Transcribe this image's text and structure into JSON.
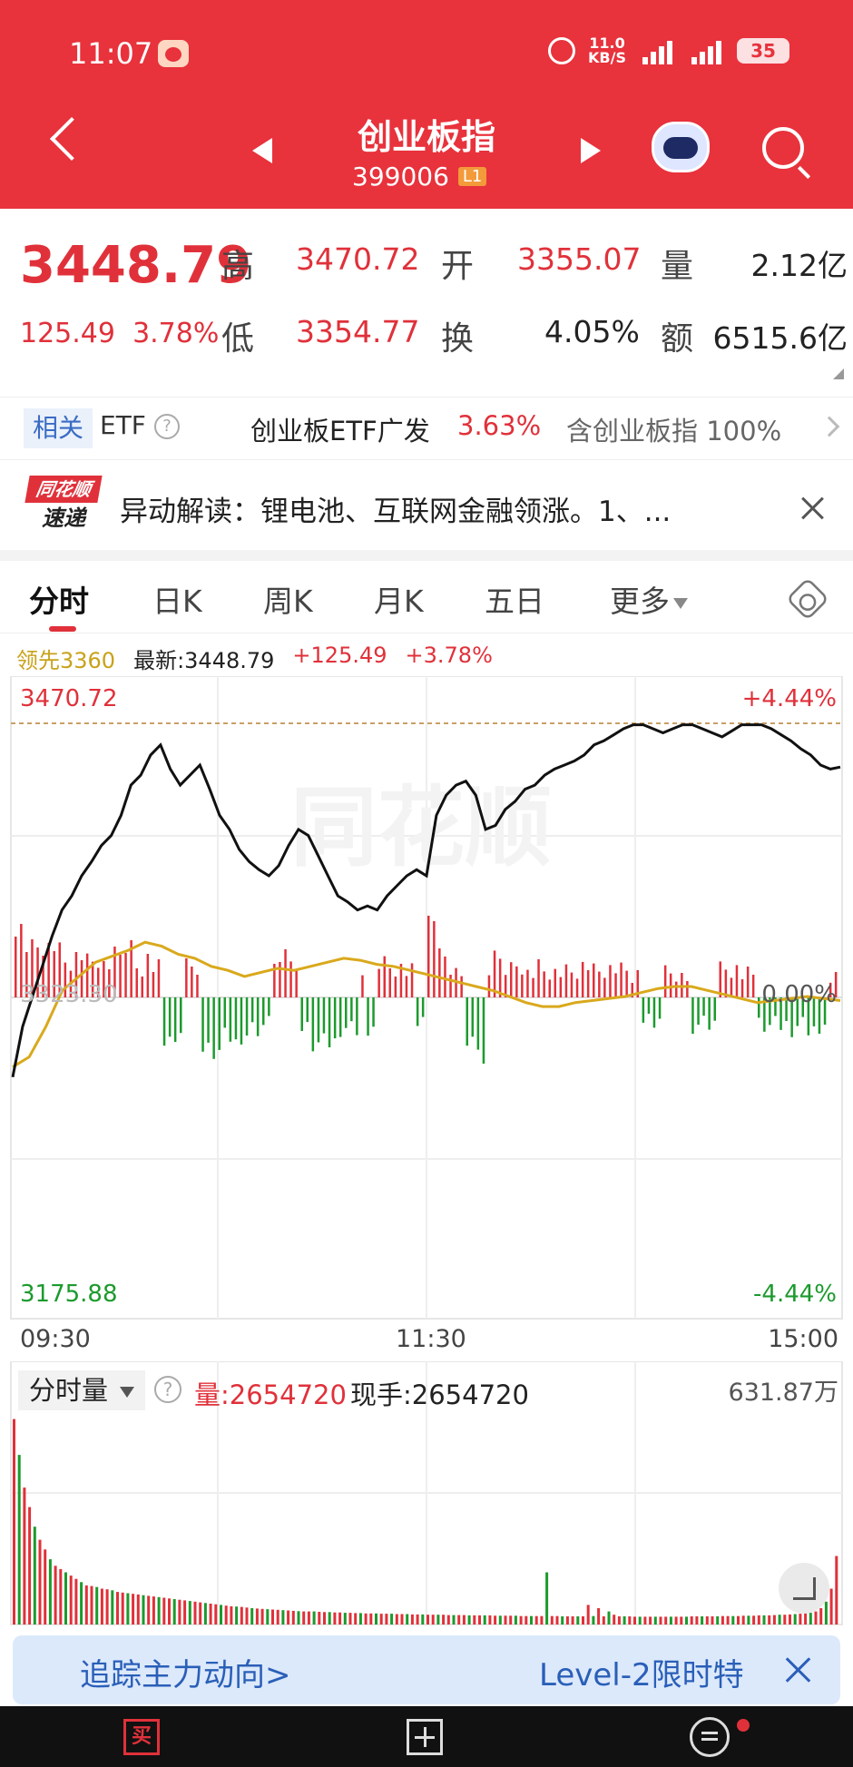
{
  "status": {
    "time": "11:07",
    "speed": "11.0\nKB/S",
    "net1": "5G",
    "net2": "5G",
    "battery": "35"
  },
  "header": {
    "title": "创业板指",
    "code": "399006",
    "level": "L1"
  },
  "quote": {
    "price": "3448.79",
    "change": "125.49",
    "change_pct": "3.78%",
    "high_label": "高",
    "high": "3470.72",
    "open_label": "开",
    "open": "3355.07",
    "volume_label": "量",
    "volume": "2.12亿",
    "low_label": "低",
    "low": "3354.77",
    "turnover_label": "换",
    "turnover": "4.05%",
    "amount_label": "额",
    "amount": "6515.6亿"
  },
  "related": {
    "tag": "相关",
    "type": "ETF",
    "help": "?",
    "name": "创业板ETF广发",
    "pct": "3.63%",
    "contains": "含创业板指 100%"
  },
  "news": {
    "logo_top": "同花顺",
    "logo_bottom": "速递",
    "text": "异动解读：锂电池、互联网金融领涨。1、..."
  },
  "tabs": [
    {
      "label": "分时"
    },
    {
      "label": "日K"
    },
    {
      "label": "周K"
    },
    {
      "label": "月K"
    },
    {
      "label": "五日"
    },
    {
      "label": "更多"
    }
  ],
  "info": {
    "lead": "领先3360",
    "latest": "最新:3448.79",
    "chg": "+125.49",
    "pct": "+3.78%"
  },
  "chart_labels": {
    "top_price": "3470.72",
    "top_pct": "+4.44%",
    "mid_price": "3323.30",
    "mid_pct": "0.00%",
    "bottom_price": "3175.88",
    "bottom_pct": "-4.44%",
    "watermark": "同花顺"
  },
  "time_axis": [
    "09:30",
    "11:30",
    "15:00"
  ],
  "volume_header": {
    "select": "分时量",
    "help": "?",
    "amount": "量:2654720",
    "hand": "现手:2654720",
    "max": "631.87万"
  },
  "promo": {
    "left": "追踪主力动向>",
    "right": "Level-2限时特"
  },
  "bottom_bar": {
    "buy": "买"
  },
  "colors": {
    "brand": "#e8323c",
    "up": "#e0313a",
    "down": "#1c9a2d",
    "avg_line": "#d9a91c"
  },
  "chart_data": {
    "type": "line",
    "title": "",
    "xlabel": "",
    "ylabel": "",
    "x_ticks": [
      "09:30",
      "11:30",
      "15:00"
    ],
    "ylim": [
      3175.88,
      3470.72
    ],
    "pct_range": [
      "-4.44%",
      "+4.44%"
    ],
    "prev_close": 3323.3,
    "series": [
      {
        "name": "最新",
        "values": [
          3295,
          3320,
          3335,
          3350,
          3365,
          3378,
          3385,
          3395,
          3402,
          3410,
          3415,
          3425,
          3440,
          3445,
          3455,
          3460,
          3448,
          3440,
          3445,
          3450,
          3438,
          3425,
          3418,
          3408,
          3402,
          3398,
          3395,
          3400,
          3410,
          3418,
          3415,
          3405,
          3395,
          3385,
          3382,
          3378,
          3380,
          3378,
          3385,
          3390,
          3395,
          3398,
          3395,
          3425,
          3435,
          3440,
          3442,
          3435,
          3418,
          3420,
          3428,
          3432,
          3438,
          3440,
          3445,
          3448,
          3450,
          3452,
          3455,
          3460,
          3462,
          3465,
          3468,
          3470,
          3470,
          3468,
          3466,
          3468,
          3470,
          3470,
          3468,
          3466,
          3464,
          3467,
          3470,
          3470,
          3470,
          3468,
          3465,
          3462,
          3458,
          3455,
          3450,
          3448,
          3449
        ]
      },
      {
        "name": "领先",
        "values": [
          3300,
          3305,
          3320,
          3338,
          3345,
          3352,
          3355,
          3358,
          3362,
          3360,
          3356,
          3354,
          3350,
          3348,
          3345,
          3347,
          3349,
          3348,
          3350,
          3352,
          3354,
          3353,
          3351,
          3350,
          3348,
          3346,
          3344,
          3342,
          3340,
          3338,
          3335,
          3332,
          3330,
          3330,
          3332,
          3333,
          3334,
          3335,
          3337,
          3339,
          3340,
          3340,
          3338,
          3336,
          3334,
          3332,
          3333,
          3334,
          3335,
          3334,
          3333
        ]
      }
    ],
    "volume_bars": [
      630,
      520,
      420,
      360,
      300,
      260,
      230,
      200,
      180,
      170,
      160,
      150,
      140,
      130,
      120,
      118,
      115,
      110,
      108,
      105,
      100,
      98,
      96,
      94,
      92,
      90,
      88,
      86,
      84,
      82,
      80,
      78,
      76,
      74,
      72,
      70,
      68,
      66,
      64,
      62,
      60,
      58,
      56,
      55,
      54,
      52,
      50,
      49,
      48,
      47,
      46,
      45,
      44,
      43,
      42,
      41,
      40,
      40,
      40,
      39,
      38,
      38,
      37,
      37,
      36,
      36,
      35,
      35,
      34,
      34,
      34,
      33,
      33,
      33,
      32,
      32,
      32,
      31,
      31,
      31,
      30,
      30,
      30,
      30,
      29,
      29,
      29,
      29,
      28,
      28,
      28,
      28,
      28,
      27,
      27,
      27,
      27,
      27,
      26,
      26,
      26,
      26,
      26,
      160,
      26,
      26,
      25,
      25,
      25,
      25,
      25,
      60,
      26,
      50,
      25,
      40,
      30,
      25,
      25,
      25,
      24,
      24,
      24,
      24,
      24,
      24,
      24,
      24,
      24,
      24,
      24,
      25,
      25,
      25,
      25,
      25,
      25,
      26,
      26,
      26,
      26,
      27,
      27,
      27,
      28,
      28,
      28,
      29,
      30,
      30,
      31,
      32,
      33,
      34,
      36,
      40,
      50,
      70,
      110,
      210
    ],
    "volume_max": "631.87万"
  }
}
